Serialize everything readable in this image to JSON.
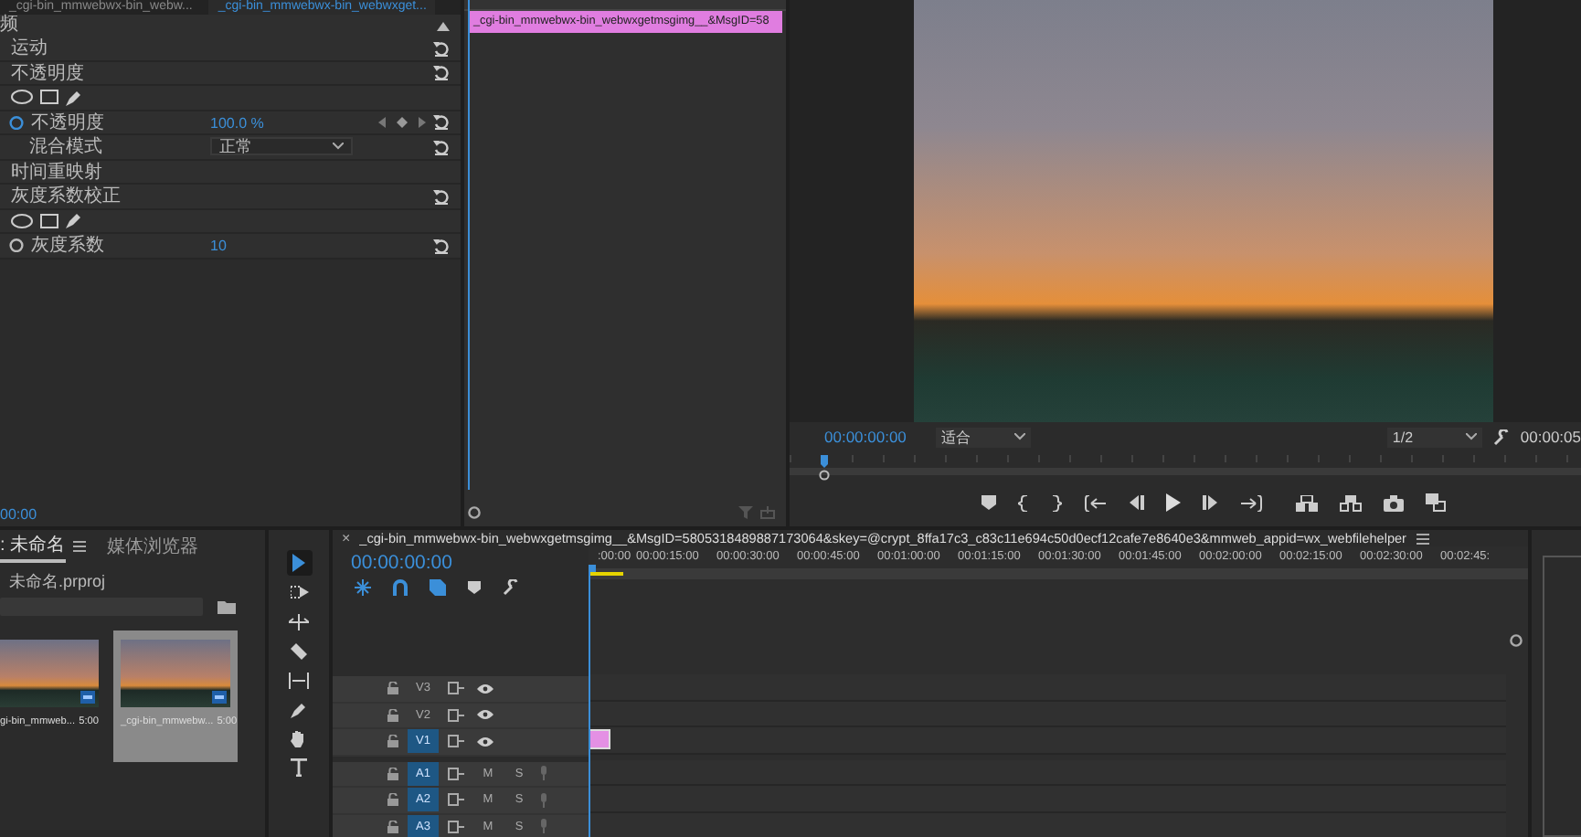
{
  "effect_tabs": [
    {
      "label": "_cgi-bin_mmwebwx-bin_webw...",
      "selected": false
    },
    {
      "label": "_cgi-bin_mmwebwx-bin_webwxget...",
      "selected": true
    }
  ],
  "effect_controls": {
    "section": "频",
    "rows": [
      {
        "kind": "group",
        "label": "运动",
        "reset": true
      },
      {
        "kind": "group",
        "label": "不透明度",
        "reset": true
      },
      {
        "kind": "masks"
      },
      {
        "kind": "param",
        "label": "不透明度",
        "value": "100.0 %",
        "keyframes": true,
        "reset": true
      },
      {
        "kind": "select",
        "label": "混合模式",
        "value": "正常",
        "reset": true
      },
      {
        "kind": "group",
        "label": "时间重映射",
        "reset": false
      },
      {
        "kind": "group",
        "label": "灰度系数校正",
        "reset": true
      },
      {
        "kind": "masks"
      },
      {
        "kind": "param",
        "label": "灰度系数",
        "value": "10",
        "keyframes": false,
        "reset": true
      }
    ],
    "timecode": "00:00"
  },
  "mini_timeline": {
    "clip": "_cgi-bin_mmwebwx-bin_webwxgetmsgimg__&MsgID=58"
  },
  "program": {
    "timecode": "00:00:00:00",
    "zoom": "适合",
    "resolution": "1/2",
    "duration": "00:00:05"
  },
  "project": {
    "tabs": [
      {
        "label": ": 未命名",
        "selected": true
      },
      {
        "label": "媒体浏览器",
        "selected": false
      }
    ],
    "file": "未命名.prproj",
    "items": [
      {
        "name": "gi-bin_mmweb...",
        "duration": "5:00",
        "selected": false
      },
      {
        "name": "_cgi-bin_mmwebw...",
        "duration": "5:00",
        "selected": true
      }
    ]
  },
  "tools": [
    {
      "kind": "select",
      "selected": true
    },
    {
      "kind": "track",
      "selected": false
    },
    {
      "kind": "ripple",
      "selected": false
    },
    {
      "kind": "razor",
      "selected": false
    },
    {
      "kind": "slip",
      "selected": false
    },
    {
      "kind": "pen",
      "selected": false
    },
    {
      "kind": "hand",
      "selected": false
    },
    {
      "kind": "type",
      "selected": false
    }
  ],
  "timeline": {
    "close": "×",
    "title": "_cgi-bin_mmwebwx-bin_webwxgetmsgimg__&MsgID=5805318489887173064&skey=@crypt_8ffa17c3_c83c11e694c50d0ecf12cafe7e8640e3&mmweb_appid=wx_webfilehelper",
    "timecode": "00:00:00:00",
    "ruler": [
      ":00:00",
      "00:00:15:00",
      "00:00:30:00",
      "00:00:45:00",
      "00:01:00:00",
      "00:01:15:00",
      "00:01:30:00",
      "00:01:45:00",
      "00:02:00:00",
      "00:02:15:00",
      "00:02:30:00",
      "00:02:45:"
    ],
    "tracks": [
      {
        "kind": "video",
        "name": "V3",
        "target": false,
        "clip": false
      },
      {
        "kind": "video",
        "name": "V2",
        "target": false,
        "clip": false
      },
      {
        "kind": "video",
        "name": "V1",
        "target": true,
        "clip": true
      },
      {
        "kind": "audio",
        "name": "A1",
        "target": true,
        "mute": "M",
        "solo": "S"
      },
      {
        "kind": "audio",
        "name": "A2",
        "target": true,
        "mute": "M",
        "solo": "S"
      },
      {
        "kind": "audio",
        "name": "A3",
        "target": true,
        "mute": "M",
        "solo": "S"
      }
    ]
  }
}
